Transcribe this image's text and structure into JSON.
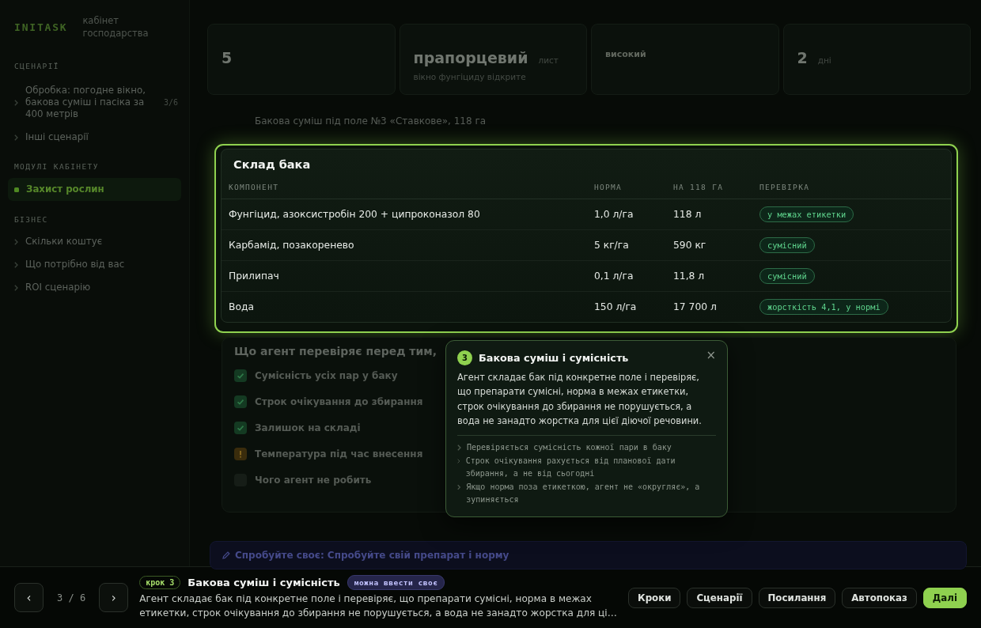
{
  "sidebar": {
    "logo": "INITASK",
    "subtitle": "кабінет господарства",
    "sections": [
      {
        "title": "СЦЕНАРІЇ",
        "items": [
          {
            "label": "Обробка: погодне вікно, бакова суміш і пасіка за 400 метрів",
            "count": "3/6",
            "selected": false
          },
          {
            "label": "Інші сценарії",
            "selected": false
          }
        ]
      },
      {
        "title": "МОДУЛІ КАБІНЕТУ",
        "items": [
          {
            "label": "Захист рослин",
            "selected": true
          }
        ]
      },
      {
        "title": "БІЗНЕС",
        "items": [
          {
            "label": "Скільки коштує",
            "selected": false
          },
          {
            "label": "Що потрібно від вас",
            "selected": false
          },
          {
            "label": "ROI сценарію",
            "selected": false
          }
        ]
      }
    ]
  },
  "stats": [
    {
      "kind": "large",
      "value": "5"
    },
    {
      "kind": "large",
      "value": "прапорцевий",
      "unit": "лист",
      "note": "вікно фунгіциду відкрите"
    },
    {
      "kind": "small",
      "value": "високий"
    },
    {
      "kind": "large",
      "value": "2",
      "unit": "дні"
    }
  ],
  "breadcrumb": "Бакова суміш під поле №3 «Ставкове», 118 га",
  "tank": {
    "title": "Склад бака",
    "columns": [
      "КОМПОНЕНТ",
      "НОРМА",
      "НА 118 ГА",
      "ПЕРЕВІРКА"
    ],
    "rows": [
      {
        "component": "Фунгіцид, азоксистробін 200 + ципроконазол 80",
        "rate": "1,0 л/га",
        "total": "118 л",
        "check": "у межах етикетки"
      },
      {
        "component": "Карбамід, позакоренево",
        "rate": "5 кг/га",
        "total": "590 кг",
        "check": "сумісний"
      },
      {
        "component": "Прилипач",
        "rate": "0,1 л/га",
        "total": "11,8 л",
        "check": "сумісний"
      },
      {
        "component": "Вода",
        "rate": "150 л/га",
        "total": "17 700 л",
        "check": "жорсткість 4,1, у нормі"
      }
    ]
  },
  "checks": {
    "title": "Що агент перевіряє перед тим,",
    "items": [
      {
        "kind": "ok",
        "label": "Сумісність усіх пар у баку"
      },
      {
        "kind": "ok",
        "label": "Строк очікування до збирання"
      },
      {
        "kind": "ok",
        "label": "Залишок на складі"
      },
      {
        "kind": "warn",
        "label": "Температура під час внесення"
      },
      {
        "kind": "note",
        "label": "Чого агент не робить"
      }
    ]
  },
  "try": {
    "label": "Спробуйте своє: Спробуйте свій препарат і норму"
  },
  "popover": {
    "step": "3",
    "title": "Бакова суміш і сумісність",
    "close": "×",
    "text": "Агент складає бак під конкретне поле і перевіряє, що препарати сумісні, норма в межах етикетки, строк очікування до збирання не порушується, а вода не занадто жорстка для цієї діючої речовини.",
    "points": [
      "Перевіряється сумісність кожної пари в баку",
      "Строк очікування рахується від планової дати збирання, а не від сьогодні",
      "Якщо норма поза етикеткою, агент не «округляє», а зупиняється"
    ]
  },
  "tour": {
    "prev": "‹",
    "position": "3 / 6",
    "next": "›",
    "step": "крок 3",
    "title": "Бакова суміш і сумісність",
    "tag": "можна ввести своє",
    "text": "Агент складає бак під конкретне поле і перевіряє, що препарати сумісні, норма в межах етикетки, строк очікування до збирання не порушується, а вода не занадто жорстка для ці…",
    "buttons": [
      {
        "label": "Кроки",
        "kind": "secondary"
      },
      {
        "label": "Сценарії",
        "kind": "secondary"
      },
      {
        "label": "Посилання",
        "kind": "secondary"
      },
      {
        "label": "Автопоказ",
        "kind": "secondary"
      },
      {
        "label": "Далі",
        "kind": "primary"
      }
    ]
  }
}
